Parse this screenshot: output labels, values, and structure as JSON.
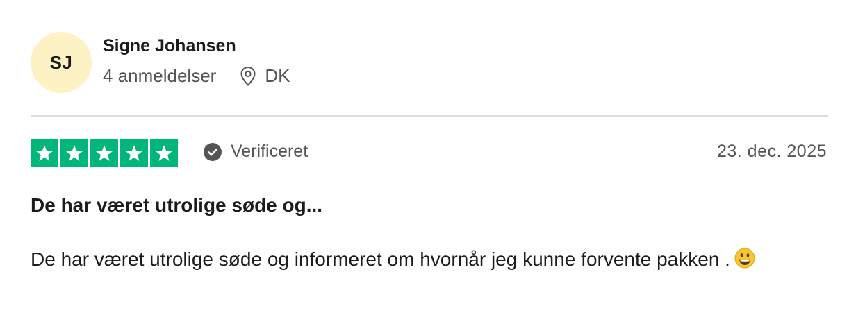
{
  "reviewer": {
    "initials": "SJ",
    "name": "Signe Johansen",
    "review_count": "4 anmeldelser",
    "country": "DK",
    "location_icon": "map-pin-icon",
    "avatar_color": "#fdf2c3"
  },
  "review": {
    "rating": 5,
    "max_rating": 5,
    "star_color": "#00b67a",
    "verified_label": "Verificeret",
    "verified_icon": "check-circle-icon",
    "date": "23. dec. 2025",
    "title": "De har været utrolige søde og...",
    "body": "De har været utrolige søde og informeret om hvornår jeg kunne forvente pakken .",
    "emoji_icon": "grinning-face-emoji-icon"
  }
}
